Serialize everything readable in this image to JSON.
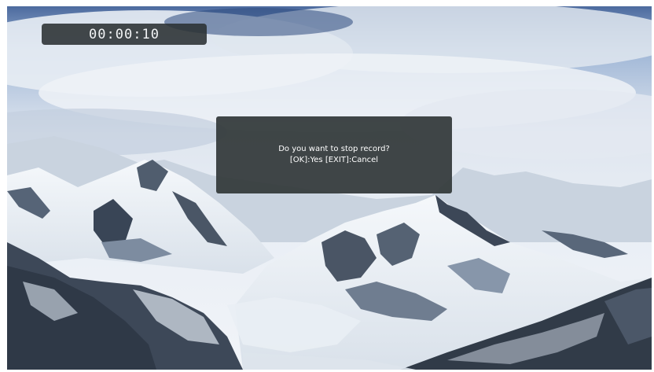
{
  "recording": {
    "elapsed_time": "00:00:10"
  },
  "stop_record_dialog": {
    "message": "Do you want to stop record?",
    "options": "[OK]:Yes [EXIT]:Cancel"
  },
  "background": {
    "scene": "snowy mountain range under cloudy sky",
    "colors": {
      "sky": "#c9d6e6",
      "snow": "#eef2f7",
      "rock": "#3f4a57",
      "panel": "#343a3c"
    }
  }
}
